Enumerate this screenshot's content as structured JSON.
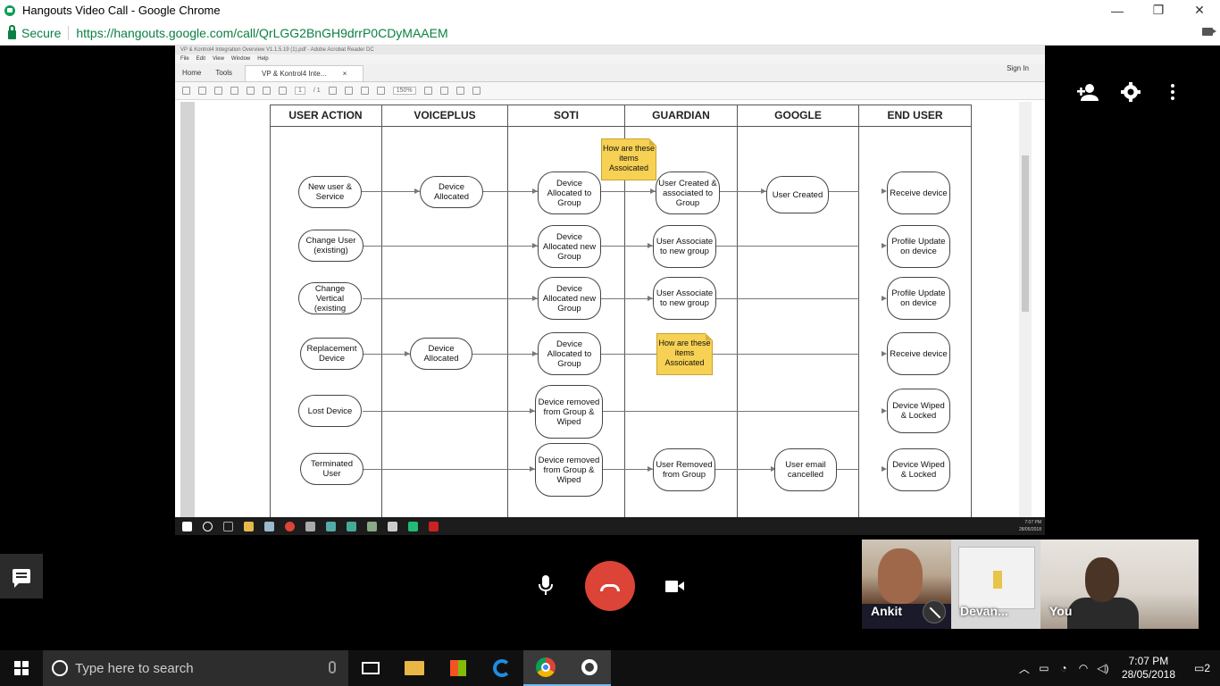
{
  "window": {
    "title": "Hangouts Video Call - Google Chrome",
    "minimize": "—",
    "restore": "❐",
    "close": "✕"
  },
  "address": {
    "secure": "Secure",
    "url": "https://hangouts.google.com/call/QrLGG2BnGH9drrP0CDyMAAEM"
  },
  "acrobat": {
    "title": "VP & Kontrol4 Integration Overview V1.1.5.19 (1).pdf - Adobe Acrobat Reader DC",
    "menu": [
      "File",
      "Edit",
      "View",
      "Window",
      "Help"
    ],
    "tabs": {
      "home": "Home",
      "tools": "Tools",
      "doc": "VP & Kontrol4 Inte...",
      "doc_close": "×"
    },
    "sign_in": "Sign In",
    "page": "1",
    "pages": "/ 1",
    "zoom": "150%",
    "clock_time": "7:07 PM",
    "clock_date": "28/05/2018"
  },
  "diagram": {
    "lanes": [
      "USER ACTION",
      "VOICEPLUS",
      "SOTI",
      "GUARDIAN",
      "GOOGLE",
      "END USER"
    ],
    "rows": [
      {
        "user": "New user & Service",
        "voiceplus": "Device Allocated",
        "soti": "Device Allocated to Group",
        "guardian": "User Created & associated to Group",
        "google": "User Created",
        "end": "Receive device"
      },
      {
        "user": "Change User (existing)",
        "soti": "Device Allocated new Group",
        "guardian": "User Associate to new group",
        "end": "Profile Update on device"
      },
      {
        "user": "Change Vertical (existing",
        "soti": "Device Allocated new Group",
        "guardian": "User Associate to new group",
        "end": "Profile Update on device"
      },
      {
        "user": "Replacement Device",
        "voiceplus": "Device Allocated",
        "soti": "Device Allocated to Group",
        "end": "Receive device"
      },
      {
        "user": "Lost Device",
        "soti": "Device removed from Group & Wiped",
        "end": "Device Wiped & Locked"
      },
      {
        "user": "Terminated User",
        "soti": "Device removed from Group & Wiped",
        "guardian": "User Removed from Group",
        "google": "User email cancelled",
        "end": "Device Wiped & Locked"
      }
    ],
    "notes": [
      "How are these items Assoicated",
      "How are these items Assoicated"
    ]
  },
  "participants": [
    {
      "name": "Ankit",
      "muted": true
    },
    {
      "name": "Devan..."
    },
    {
      "name": "You"
    }
  ],
  "taskbar": {
    "search_placeholder": "Type here to search",
    "time": "7:07 PM",
    "date": "28/05/2018",
    "notifications": "2"
  },
  "colors": {
    "hangup": "#db4437",
    "secure": "#0b8043",
    "note": "#f7d154"
  }
}
